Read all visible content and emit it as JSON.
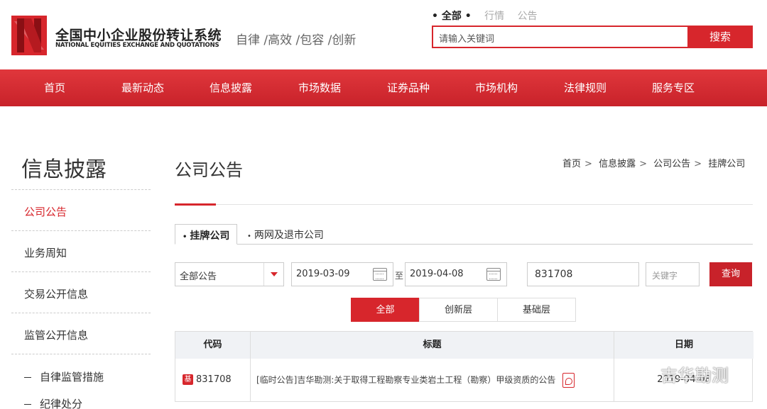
{
  "header": {
    "logo_cn": "全国中小企业股份转让系统",
    "logo_en": "NATIONAL EQUITIES EXCHANGE AND QUOTATIONS",
    "slogan": "自律 /高效 /包容 /创新",
    "search_tabs": [
      "全部",
      "行情",
      "公告"
    ],
    "search_placeholder": "请输入关键词",
    "search_button": "搜索"
  },
  "nav": [
    "首页",
    "最新动态",
    "信息披露",
    "市场数据",
    "证券品种",
    "市场机构",
    "法律规则",
    "服务专区"
  ],
  "sidebar": {
    "title": "信息披露",
    "items": [
      "公司公告",
      "业务周知",
      "交易公开信息",
      "监管公开信息"
    ],
    "sub_items": [
      "自律监管措施",
      "纪律处分"
    ]
  },
  "main": {
    "title": "公司公告",
    "breadcrumb": [
      "首页",
      "信息披露",
      "公司公告",
      "挂牌公司"
    ],
    "tabs": [
      "挂牌公司",
      "两网及退市公司"
    ],
    "filter": {
      "type": "全部公告",
      "start_date": "2019-03-09",
      "date_separator": "至",
      "end_date": "2019-04-08",
      "code": "831708",
      "keyword_placeholder": "关键字",
      "query_button": "查询"
    },
    "segments": [
      "全部",
      "创新层",
      "基础层"
    ],
    "table": {
      "columns": [
        "代码",
        "标题",
        "日期"
      ],
      "rows": [
        {
          "badge": "基",
          "code": "831708",
          "title": "[临时公告]吉华勘测:关于取得工程勘察专业类岩土工程（勘察）甲级资质的公告",
          "date": "2019-04-08"
        }
      ]
    }
  },
  "watermark": "吉华勘测",
  "colors": {
    "brand_red": "#d7262c",
    "nav_red": "#d2262d",
    "header_gray": "#f0f2f5"
  }
}
